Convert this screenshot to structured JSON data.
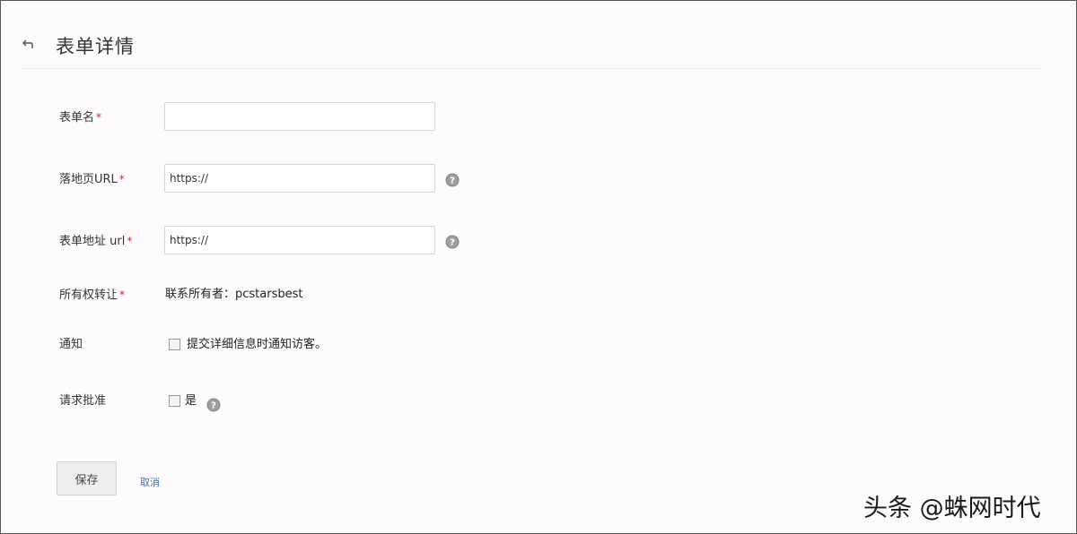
{
  "header": {
    "title": "表单详情",
    "back_icon": "back-arrow-icon"
  },
  "form": {
    "form_name": {
      "label": "表单名",
      "required_mark": "*",
      "value": ""
    },
    "landing_url": {
      "label": "落地页URL",
      "required_mark": "*",
      "value": "https://",
      "help_icon": "question-circle-icon"
    },
    "form_address_url": {
      "label": "表单地址 url",
      "required_mark": "*",
      "value": "https://",
      "help_icon": "question-circle-icon"
    },
    "ownership": {
      "label": "所有权转让",
      "required_mark": "*",
      "value": "联系所有者：pcstarsbest"
    },
    "notify": {
      "label": "通知",
      "checkbox_label": "提交详细信息时通知访客。",
      "checked": false
    },
    "request_approval": {
      "label": "请求批准",
      "checkbox_label": "是",
      "checked": false,
      "help_icon": "question-circle-icon"
    }
  },
  "actions": {
    "save_label": "保存",
    "cancel_label": "取消"
  },
  "watermark": {
    "text": "头条 @蛛网时代"
  },
  "colors": {
    "required": "#cc2a2a",
    "link": "#4a6fa5",
    "help_icon_bg": "#8a8a8a",
    "page_bg": "#fdfbfd"
  }
}
